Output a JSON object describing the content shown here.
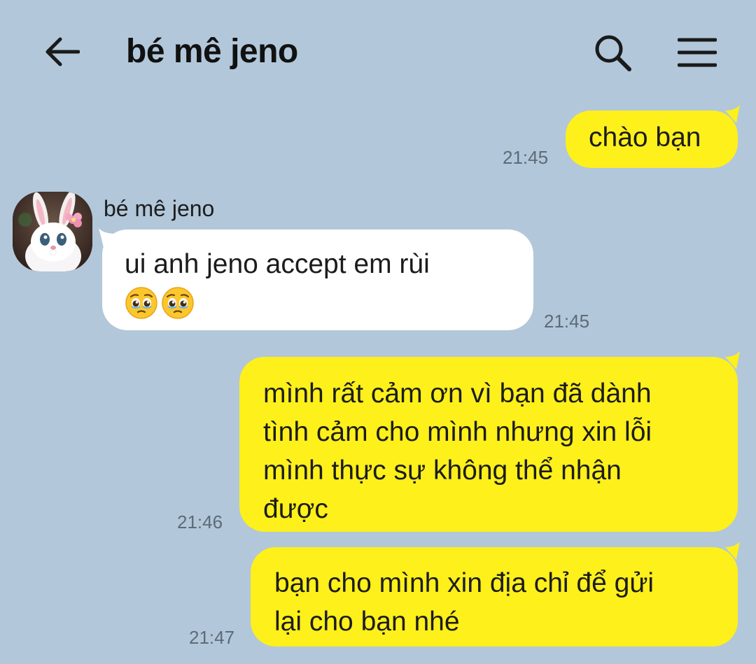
{
  "header": {
    "title": "bé mê jeno"
  },
  "icons": {
    "back": "arrow-left-icon",
    "search": "search-icon",
    "menu": "hamburger-menu-icon"
  },
  "colors": {
    "background": "#b2c7da",
    "my_bubble": "#fef01b",
    "their_bubble": "#ffffff",
    "timestamp": "#5d6b78"
  },
  "messages": [
    {
      "sender": "me",
      "text": "chào bạn",
      "time": "21:45"
    },
    {
      "sender": "bé mê jeno",
      "text": "ui anh jeno accept em rùi",
      "emoji": "pleading-face-icon x2",
      "time": "21:45"
    },
    {
      "sender": "me",
      "lines": [
        "mình rất cảm ơn vì bạn đã dành",
        "tình cảm cho mình nhưng xin lỗi",
        "mình thực sự không thể nhận",
        "được"
      ],
      "time": "21:46"
    },
    {
      "sender": "me",
      "lines": [
        "bạn cho mình xin địa chỉ để gửi",
        "lại cho bạn nhé"
      ],
      "time": "21:47"
    }
  ]
}
